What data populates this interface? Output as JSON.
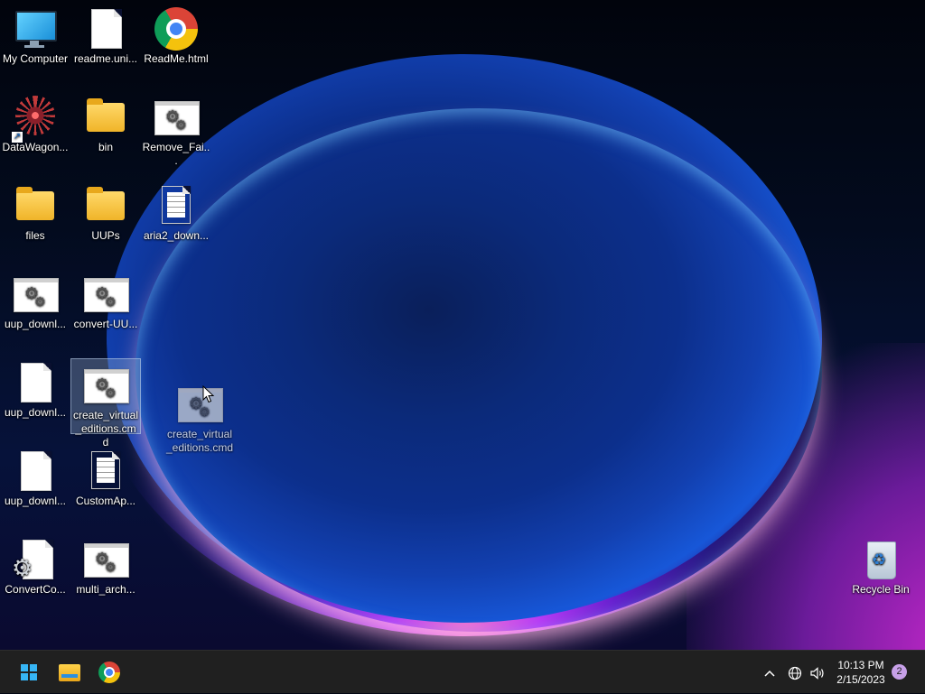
{
  "desktop": {
    "icons": [
      {
        "label": "My Computer",
        "type": "computer"
      },
      {
        "label": "readme.uni...",
        "type": "document"
      },
      {
        "label": "ReadMe.html",
        "type": "chrome"
      },
      {
        "label": "DataWagon...",
        "type": "shortcut"
      },
      {
        "label": "bin",
        "type": "folder"
      },
      {
        "label": "Remove_Fai...",
        "type": "cmd"
      },
      {
        "label": "files",
        "type": "folder"
      },
      {
        "label": "UUPs",
        "type": "folder"
      },
      {
        "label": "aria2_down...",
        "type": "text"
      },
      {
        "label": "uup_downl...",
        "type": "cmd"
      },
      {
        "label": "convert-UU...",
        "type": "cmd"
      },
      {
        "label": "uup_downl...",
        "type": "document"
      },
      {
        "label": "create_virtual_editions.cmd",
        "type": "cmd",
        "selected": true
      },
      {
        "label": "uup_downl...",
        "type": "document"
      },
      {
        "label": "CustomAp...",
        "type": "text"
      },
      {
        "label": "ConvertCo...",
        "type": "config"
      },
      {
        "label": "multi_arch...",
        "type": "cmd"
      },
      {
        "label": "Recycle Bin",
        "type": "recycle-bin"
      }
    ],
    "drag_ghost": {
      "label": "create_virtual_editions.cmd"
    }
  },
  "taskbar": {
    "pinned": [
      "start",
      "file-explorer",
      "chrome"
    ],
    "tray": {
      "overflow_icon": "chevron-up-icon",
      "network_icon": "globe-icon",
      "volume_icon": "speaker-icon"
    },
    "clock": {
      "time": "10:13 PM",
      "date": "2/15/2023"
    },
    "notification_count": "2"
  },
  "colors": {
    "taskbar_bg": "#202020",
    "accent": "#36b5f5",
    "selection": "#96afcd",
    "badge": "#c7a0e8"
  }
}
